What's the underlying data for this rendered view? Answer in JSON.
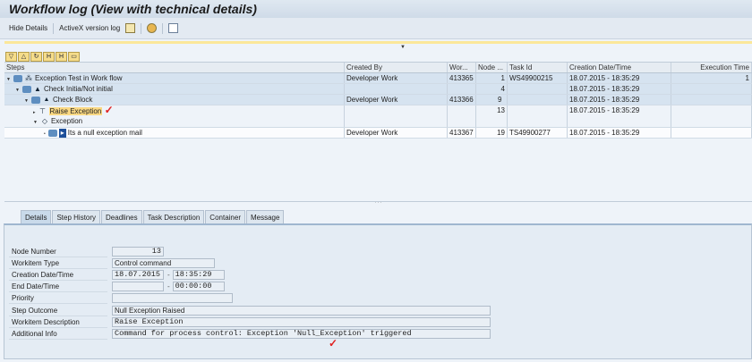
{
  "title": "Workflow log (View with technical details)",
  "toolbar": {
    "hide_details": "Hide Details",
    "activex": "ActiveX version log"
  },
  "grid": {
    "headers": [
      "Steps",
      "Created By",
      "Wor...",
      "Node ...",
      "Task Id",
      "Creation Date/Time",
      "Execution Time"
    ],
    "rows": [
      {
        "step": "Exception Test in Work flow",
        "created_by": "Developer Work",
        "wi": "413365",
        "node": "1",
        "task": "WS49900215",
        "created": "18.07.2015 - 18:35:29",
        "exec": "1"
      },
      {
        "step": "Check Initia/Not initial",
        "created_by": "",
        "wi": "",
        "node": "4",
        "task": "",
        "created": "18.07.2015 - 18:35:29",
        "exec": ""
      },
      {
        "step": "Check Block",
        "created_by": "Developer Work",
        "wi": "413366",
        "node": "9",
        "task": "",
        "created": "18.07.2015 - 18:35:29",
        "exec": ""
      },
      {
        "step": "Raise Exception",
        "step2": "Exception",
        "created_by": "",
        "wi": "",
        "node": "13",
        "task": "",
        "created": "18.07.2015 - 18:35:29",
        "exec": ""
      },
      {
        "step": "Its a null exception mail",
        "created_by": "Developer Work",
        "wi": "413367",
        "node": "19",
        "task": "TS49900277",
        "created": "18.07.2015 - 18:35:29",
        "exec": ""
      }
    ]
  },
  "tabs": [
    "Details",
    "Step History",
    "Deadlines",
    "Task Description",
    "Container",
    "Message"
  ],
  "details": {
    "node_number": {
      "label": "Node Number",
      "value": "13"
    },
    "workitem_type": {
      "label": "Workitem Type",
      "value": "Control command"
    },
    "creation": {
      "label": "Creation Date/Time",
      "date": "18.07.2015",
      "time": "18:35:29"
    },
    "end": {
      "label": "End Date/Time",
      "date": "",
      "time": "00:00:00"
    },
    "priority": {
      "label": "Priority",
      "value": ""
    },
    "step_outcome": {
      "label": "Step Outcome",
      "value": "Null Exception Raised"
    },
    "workitem_description": {
      "label": "Workitem Description",
      "value": "Raise Exception"
    },
    "additional_info": {
      "label": "Additional Info",
      "value": "Command for process control: Exception 'Null_Exception' triggered"
    }
  },
  "colors": {
    "highlight": "#fbd983",
    "annotation": "#e02020"
  }
}
